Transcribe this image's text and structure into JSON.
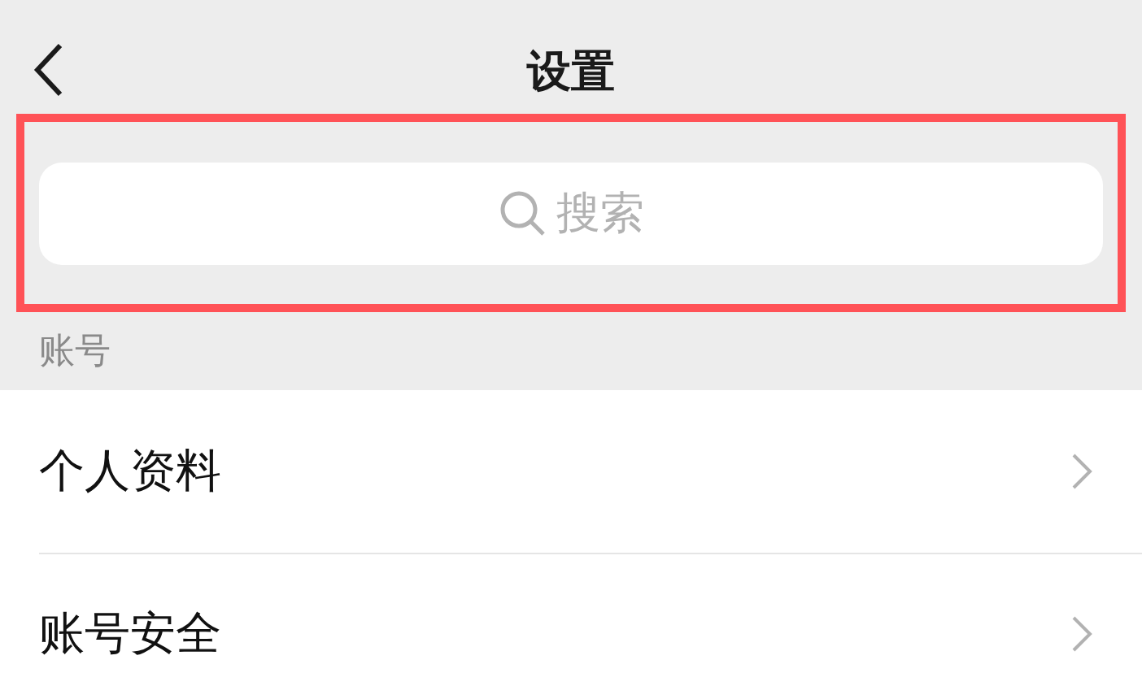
{
  "nav_bar": {
    "title": "设置"
  },
  "search": {
    "placeholder": "搜索",
    "highlighted": true
  },
  "sections": [
    {
      "header": "账号",
      "items": [
        {
          "label": "个人资料"
        },
        {
          "label": "账号安全"
        }
      ]
    }
  ]
}
